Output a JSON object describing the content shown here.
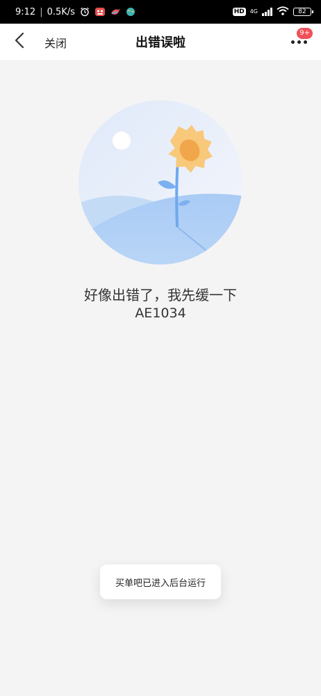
{
  "status_bar": {
    "time": "9:12",
    "separator": "|",
    "network_speed": "0.5K/s",
    "hd_badge": "HD",
    "network_type": "4G",
    "battery": "82"
  },
  "nav": {
    "close_label": "关闭",
    "title": "出错误啦",
    "more_badge": "9+"
  },
  "error": {
    "message": "好像出错了，我先缓一下",
    "code": "AE1034"
  },
  "toast": {
    "text": "买单吧已进入后台运行"
  },
  "colors": {
    "accent_badge": "#f0505a",
    "illustration_blue": "#9fc5f5",
    "sunflower": "#f8c97a"
  }
}
